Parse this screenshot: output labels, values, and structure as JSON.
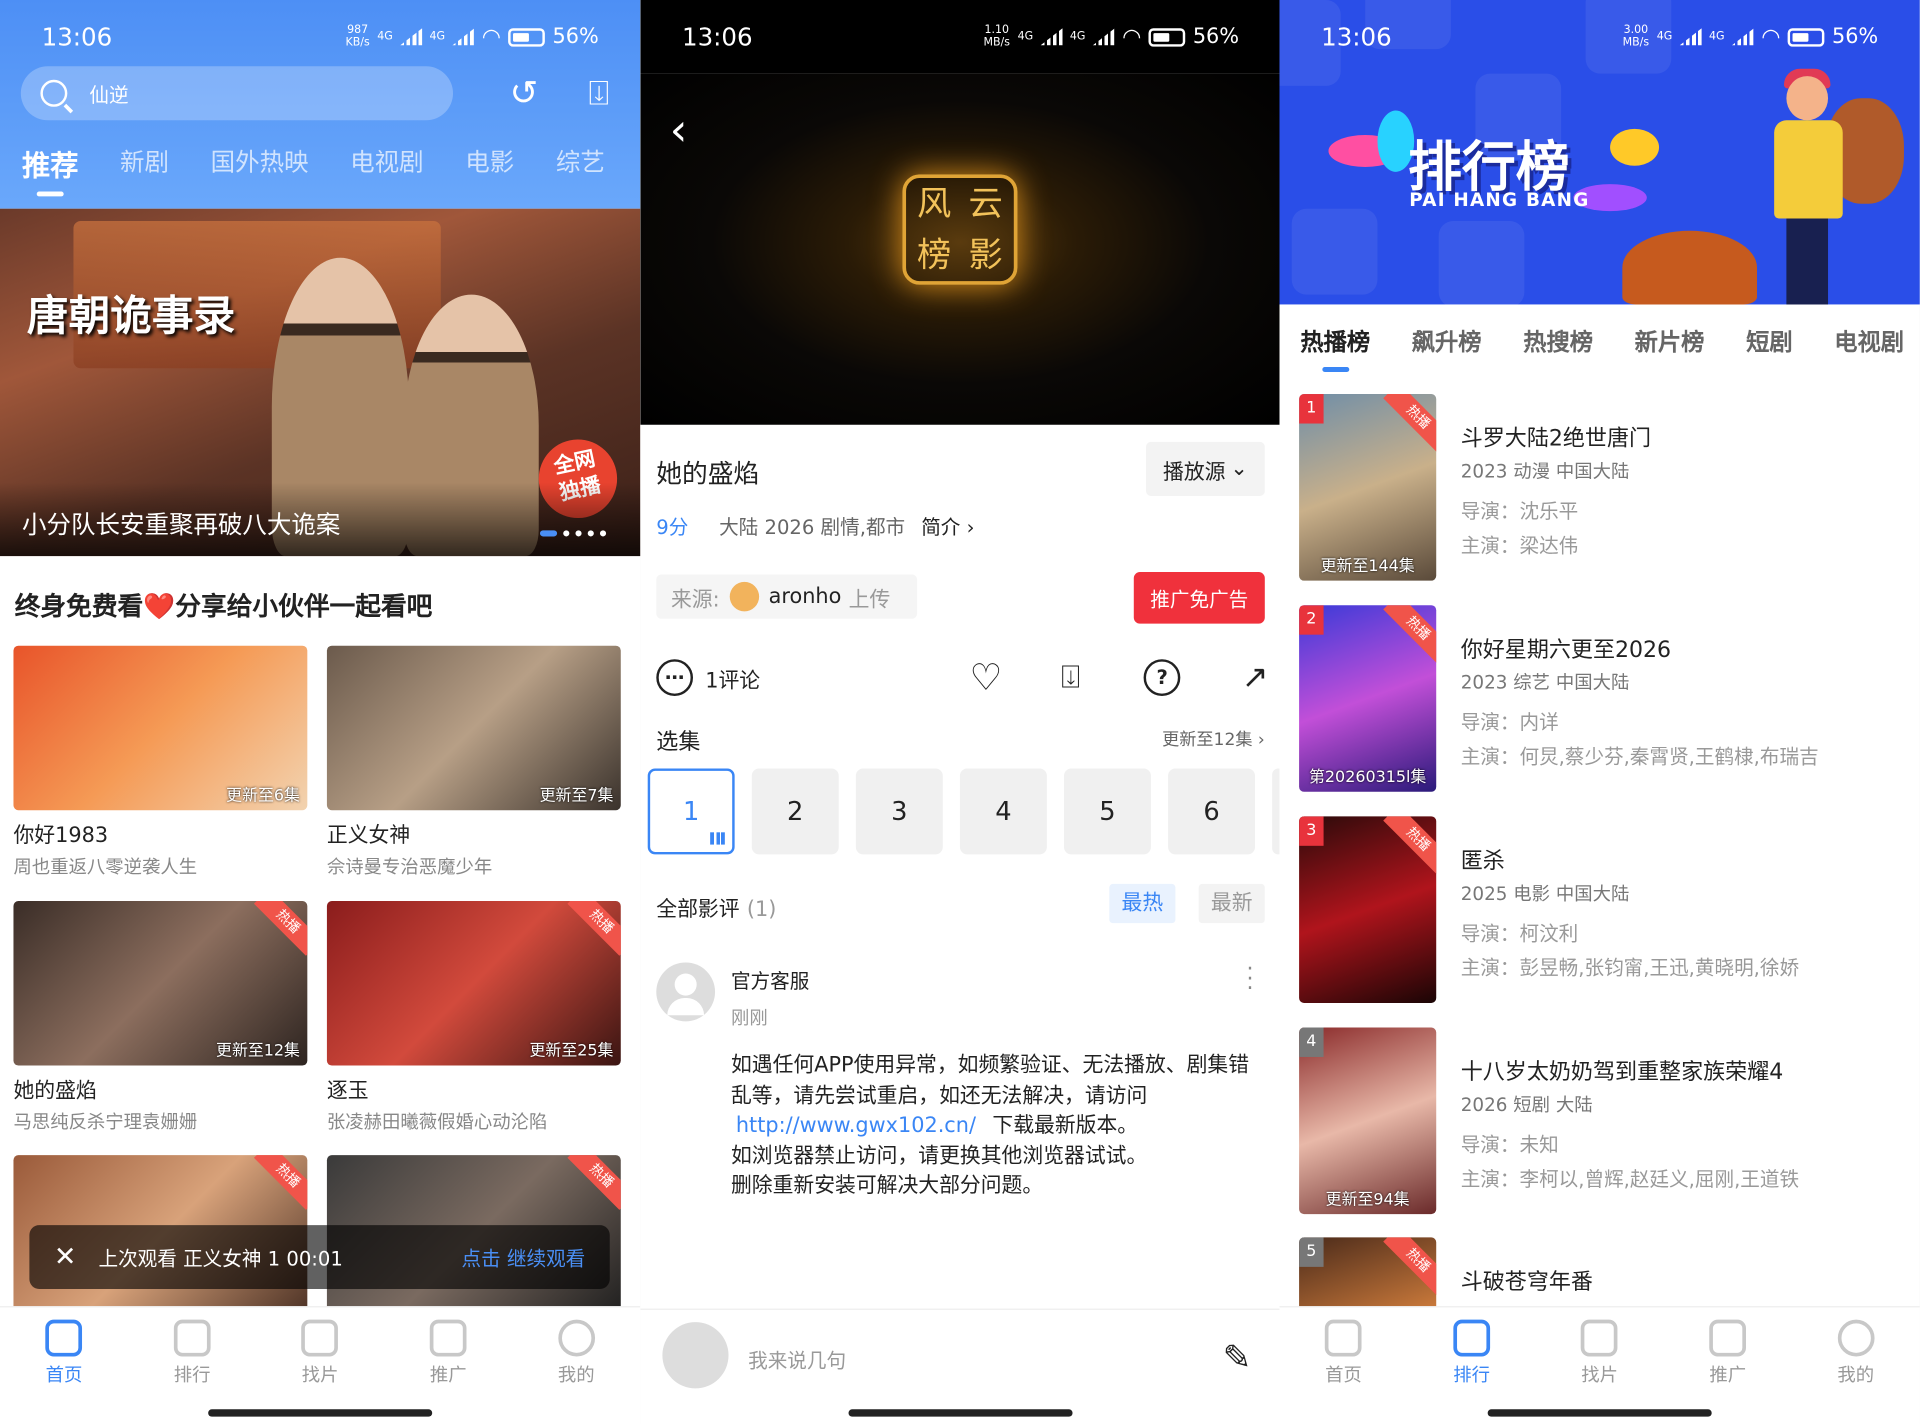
{
  "status_bars": [
    {
      "time": "13:06",
      "speed": "987 KB/s",
      "net1": "4G",
      "net2": "4G",
      "battery": "56%"
    },
    {
      "time": "13:06",
      "speed": "1.10 MB/s",
      "net1": "4G",
      "net2": "4G",
      "battery": "56%"
    },
    {
      "time": "13:06",
      "speed": "3.00 MB/s",
      "net1": "4G",
      "net2": "4G",
      "battery": "56%"
    }
  ],
  "home": {
    "search_placeholder": "仙逆",
    "tabs": [
      "推荐",
      "新剧",
      "国外热映",
      "电视剧",
      "电影",
      "综艺"
    ],
    "banner": {
      "logo": "唐朝诡事录",
      "badge_line1": "全网",
      "badge_line2": "独播",
      "caption": "小分队长安重聚再破八大诡案"
    },
    "slogan": "终身免费看❤️分享给小伙伴一起看吧",
    "cards": [
      {
        "title": "你好1983",
        "desc": "周也重返八零逆袭人生",
        "update": "更新至6集",
        "hot": ""
      },
      {
        "title": "正义女神",
        "desc": "佘诗曼专治恶魔少年",
        "update": "更新至7集",
        "hot": ""
      },
      {
        "title": "她的盛焰",
        "desc": "马思纯反杀宁理袁姗姗",
        "update": "更新至12集",
        "hot": "热播"
      },
      {
        "title": "逐玉",
        "desc": "张凌赫田曦薇假婚心动沦陷",
        "update": "更新至25集",
        "hot": "热播"
      },
      {
        "title": "",
        "desc": "",
        "update": "",
        "hot": "热播"
      },
      {
        "title": "",
        "desc": "",
        "update": "",
        "hot": "热播"
      }
    ],
    "last_watch": {
      "text": "上次观看 正义女神 1 00:01",
      "action": "点击 继续观看"
    }
  },
  "nav": [
    "首页",
    "排行",
    "找片",
    "推广",
    "我的"
  ],
  "detail": {
    "seal_chars": [
      "风",
      "云",
      "榜",
      "影"
    ],
    "title": "她的盛焰",
    "source_btn": "播放源",
    "score": "9分",
    "meta": "大陆  2026  剧情,都市",
    "intro": "简介 ›",
    "from_label": "来源:",
    "uploader": "aronho",
    "uploaded": "上传",
    "promo_btn": "推广免广告",
    "comments_count": "1评论",
    "select_label": "选集",
    "update_info": "更新至12集 ›",
    "episodes": [
      "1",
      "2",
      "3",
      "4",
      "5",
      "6"
    ],
    "all_reviews": "全部影评",
    "reviews_count": "(1)",
    "sort_hot": "最热",
    "sort_new": "最新",
    "comment": {
      "author": "官方客服",
      "time": "刚刚",
      "line1": "如遇任何APP使用异常，如频繁验证、无法播放、剧集错乱等，请先尝试重启，如还无法解决，请访问",
      "link": "http://www.gwx102.cn/",
      "line2": "下载最新版本。",
      "line3": "如浏览器禁止访问，请更换其他浏览器试试。",
      "line4": "删除重新安装可解决大部分问题。"
    },
    "input_placeholder": "我来说几句"
  },
  "rank": {
    "title": "排行榜",
    "subtitle": "PAI HANG BANG",
    "tabs": [
      "热播榜",
      "飙升榜",
      "热搜榜",
      "新片榜",
      "短剧",
      "电视剧"
    ],
    "items": [
      {
        "num": "1",
        "hot": "热播",
        "name": "斗罗大陆2绝世唐门",
        "info": "2023  动漫  中国大陆",
        "director": "导演：沈乐平",
        "actors": "主演：梁达伟",
        "update": "更新至144集"
      },
      {
        "num": "2",
        "hot": "热播",
        "name": "你好星期六更至2026",
        "info": "2023  综艺  中国大陆",
        "director": "导演：内详",
        "actors": "主演：何炅,蔡少芬,秦霄贤,王鹤棣,布瑞吉",
        "update": "第20260315l集"
      },
      {
        "num": "3",
        "hot": "热播",
        "name": "匿杀",
        "info": "2025  电影  中国大陆",
        "director": "导演：柯汶利",
        "actors": "主演：彭昱畅,张钧甯,王迅,黄晓明,徐娇",
        "update": ""
      },
      {
        "num": "4",
        "hot": "",
        "name": "十八岁太奶奶驾到重整家族荣耀4",
        "info": "2026  短剧  大陆",
        "director": "导演：未知",
        "actors": "主演：李柯以,曾辉,赵廷义,屈刚,王道铁",
        "update": "更新至94集"
      },
      {
        "num": "5",
        "hot": "热播",
        "name": "斗破苍穹年番",
        "info": "",
        "director": "",
        "actors": "",
        "update": ""
      }
    ]
  },
  "colors": {
    "accent": "#3a86f5",
    "hot": "#f0313c",
    "rank_bg": "#2a4ee8"
  }
}
